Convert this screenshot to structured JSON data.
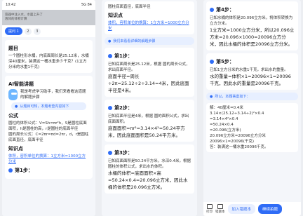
{
  "p1": {
    "status_time": "10:42",
    "status_right": "5G 84",
    "gray_lines": [
      "容器中注入水，水面上升了",
      "液体的体积计算"
    ],
    "tabs": {
      "active": "提问 1",
      "n2": "2",
      "n3": "3"
    },
    "title": "题目",
    "question": "一个圆柱形水桶，内底面周长是25.12米，水桶深40厘米，装满这一桶水重多少千克？(1立方分米的水重1千克)",
    "ai_title": "AI智能讲题",
    "bot_text": "我是考虎学习助手，我们来看看这道题的解题步骤",
    "pill": "从题目可知，本题考查内容如下",
    "formula_title": "公式",
    "formula_lines": [
      "圆柱的体积公式：V=Sh=πr²h，S是圆柱底面面积，h是圆柱的高，r是圆柱的底面半径",
      "圆的周长公式：C=2πr=πd=2πr，d，r是圆柱底面直径，底面半径"
    ],
    "knowledge_title": "知识点",
    "knowledge_text": "体积，容积单位的换算：1立方米=1000立方分米",
    "step1": "第1步："
  },
  "p2": {
    "top_text": "圆柱底面直径，底面半径",
    "knowledge_title": "知识点",
    "knowledge_text": "体积，容积单位的换算：1立方米=1000立方分米",
    "pill": "我们来看看详细的解题步骤",
    "step1": "第1步：",
    "step1_text": "已知底面周长是25.12米，根据 圆的周长公式，求出底面半径。",
    "step1_calc": "底面半径=周长÷2π=25.12÷2÷3.14=4米，因此底面半径是4米。",
    "step2": "第2步：",
    "step2_text": "已知底面半径是4米，根据 圆的面积公式，求出底面面积。",
    "step2_calc": "底面面积=πr²=3.14×4²=50.24平方米，因此底面面积是50.24平方米。",
    "step3": "第3步：",
    "step3_text": "已知底面面积是50.24平方米，水深0.4米，根据 圆柱的体积公式，求出水的体积。",
    "step3_calc": "水桶的体积=底面面积×高=50.24×0.4=20.096立方米，因此水桶的体积是20.096立方米。"
  },
  "p3": {
    "step4": "第4步：",
    "step4_text": "已知水桶的体积是20.096立方米，将体积转换为立方分米。",
    "step4_calc": "1立方米=1000立方分米，所以20.096立方米=20.096×1000=20096立方分米，因此水桶的体积是20096立方分米。",
    "step5": "第5步：",
    "step5_text": "已知1立方分米的水重1千克，求出水的重量。",
    "step5_calc": "水的重量=体积×1=20096×1=20096千克，因此水的重量是20096千克。",
    "pill": "所以，本题答案如下：",
    "answer_lines": [
      "解：40厘米=0.4米",
      "3.14×(25.12÷3.14÷2)²×0.4",
      "=3.14×4²×0.4",
      "=50.24×0.4",
      "=20.096(立方米)",
      "20.096立方米=20096立方分米",
      "20096×1=20096(千克)",
      "答：装满这一桶水重20096千克。"
    ],
    "bottom": {
      "print": "打印",
      "fav": "错题本",
      "add": "加入错题本",
      "continue": "继续拍题"
    }
  }
}
